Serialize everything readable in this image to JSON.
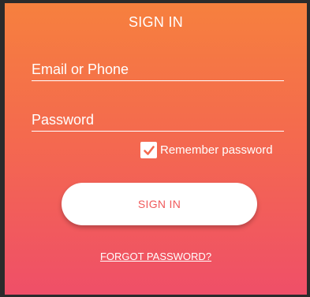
{
  "form": {
    "title": "SIGN IN",
    "email_label": "Email or Phone",
    "password_label": "Password",
    "remember_label": "Remember password",
    "remember_checked": true,
    "submit_label": "SIGN IN",
    "forgot_label": "FORGOT PASSWORD?"
  },
  "colors": {
    "gradient_top": "#f6803e",
    "gradient_bottom": "#ef4f68",
    "button_text": "#f05a5b"
  },
  "icons": {
    "checkbox": "check-icon"
  }
}
